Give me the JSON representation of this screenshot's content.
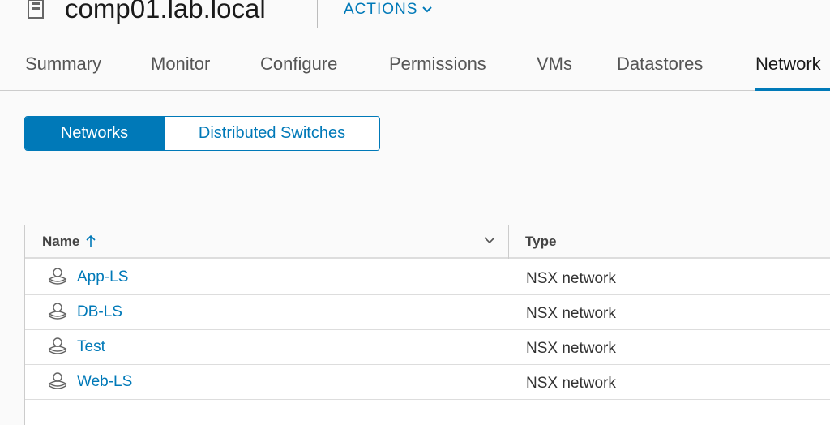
{
  "header": {
    "host_name": "comp01.lab.local",
    "actions_label": "ACTIONS"
  },
  "tabs": [
    {
      "label": "Summary"
    },
    {
      "label": "Monitor"
    },
    {
      "label": "Configure"
    },
    {
      "label": "Permissions"
    },
    {
      "label": "VMs"
    },
    {
      "label": "Datastores"
    },
    {
      "label": "Network"
    }
  ],
  "active_tab": "Network",
  "segmented": {
    "networks_label": "Networks",
    "switches_label": "Distributed Switches",
    "selected": "Networks"
  },
  "grid": {
    "columns": {
      "name": "Name",
      "type": "Type"
    },
    "sort": "ascending",
    "rows": [
      {
        "name": "App-LS",
        "type": "NSX network"
      },
      {
        "name": "DB-LS",
        "type": "NSX network"
      },
      {
        "name": "Test",
        "type": "NSX network"
      },
      {
        "name": "Web-LS",
        "type": "NSX network"
      }
    ]
  },
  "colors": {
    "accent": "#0079b8",
    "background": "#fafafa"
  },
  "icons": [
    "host-icon",
    "chevron-down-icon",
    "sort-ascending-icon",
    "network-icon"
  ]
}
